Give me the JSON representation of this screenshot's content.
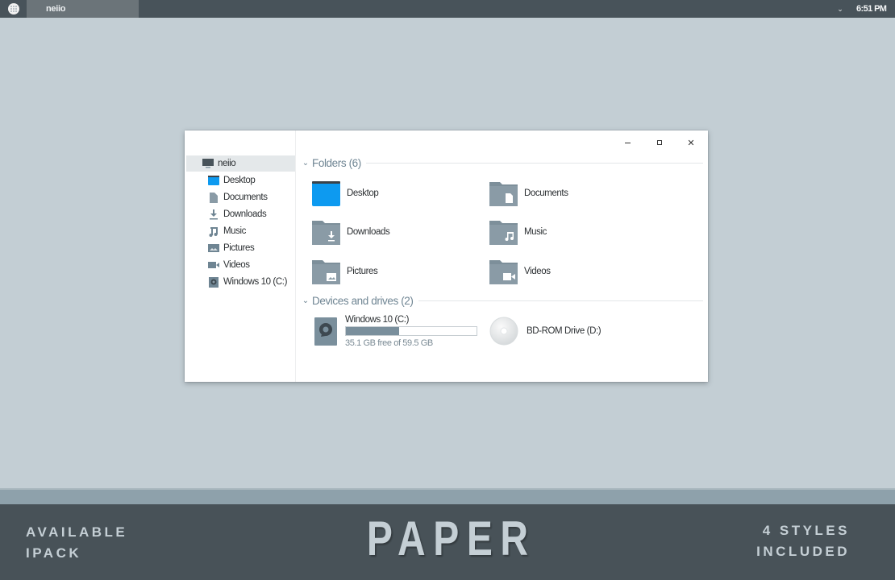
{
  "taskbar": {
    "start_icon": "start-menu-icon",
    "active_task": "neiio",
    "tray_chevron_icon": "chevron-down-icon",
    "clock": "6:51 PM"
  },
  "window": {
    "controls": {
      "minimize_icon": "minimize-icon",
      "maximize_icon": "maximize-icon",
      "close_icon": "close-icon"
    },
    "sidebar": {
      "root": {
        "label": "neiio",
        "icon": "computer-icon"
      },
      "items": [
        {
          "label": "Desktop",
          "icon": "desktop-icon"
        },
        {
          "label": "Documents",
          "icon": "document-icon"
        },
        {
          "label": "Downloads",
          "icon": "download-icon"
        },
        {
          "label": "Music",
          "icon": "music-icon"
        },
        {
          "label": "Pictures",
          "icon": "picture-icon"
        },
        {
          "label": "Videos",
          "icon": "video-icon"
        },
        {
          "label": "Windows 10 (C:)",
          "icon": "drive-icon"
        }
      ]
    },
    "folders_section": {
      "title": "Folders (6)",
      "items": [
        {
          "label": "Desktop",
          "icon": "desktop-folder-icon"
        },
        {
          "label": "Documents",
          "icon": "documents-folder-icon"
        },
        {
          "label": "Downloads",
          "icon": "downloads-folder-icon"
        },
        {
          "label": "Music",
          "icon": "music-folder-icon"
        },
        {
          "label": "Pictures",
          "icon": "pictures-folder-icon"
        },
        {
          "label": "Videos",
          "icon": "videos-folder-icon"
        }
      ]
    },
    "drives_section": {
      "title": "Devices and drives (2)",
      "drives": [
        {
          "label": "Windows 10 (C:)",
          "icon": "hard-drive-icon",
          "free_text": "35.1 GB free of 59.5 GB",
          "used_fraction": 0.41
        },
        {
          "label": "BD-ROM Drive (D:)",
          "icon": "optical-disc-icon"
        }
      ]
    }
  },
  "banner": {
    "left_lines": [
      "AVAILABLE",
      "IPACK"
    ],
    "title": "PAPER",
    "right_lines": [
      "4 STYLES",
      "INCLUDED"
    ]
  },
  "colors": {
    "desktop_bg": "#c3ced4",
    "taskbar_bg": "#48535a",
    "accent_blue": "#0d9af0",
    "folder_gray": "#8a9ba6",
    "banner_bg": "#485258"
  }
}
